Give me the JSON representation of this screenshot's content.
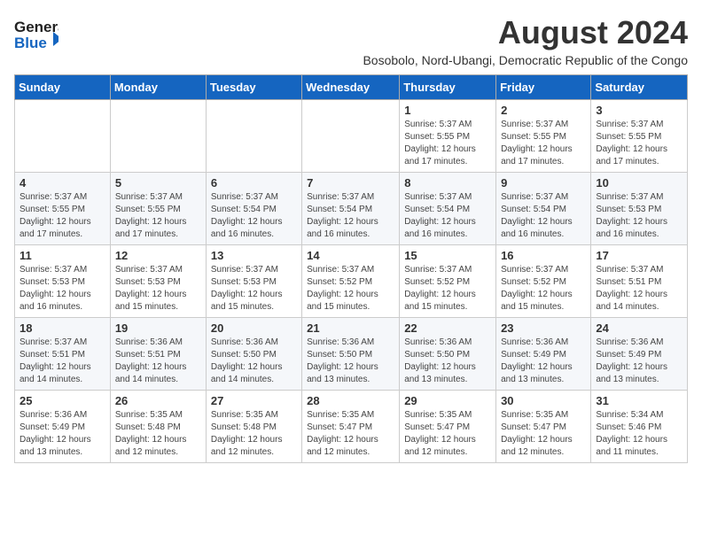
{
  "logo": {
    "general": "General",
    "blue": "Blue"
  },
  "title": "August 2024",
  "subtitle": "Bosobolo, Nord-Ubangi, Democratic Republic of the Congo",
  "days_of_week": [
    "Sunday",
    "Monday",
    "Tuesday",
    "Wednesday",
    "Thursday",
    "Friday",
    "Saturday"
  ],
  "weeks": [
    {
      "cells": [
        {
          "day": "",
          "info": ""
        },
        {
          "day": "",
          "info": ""
        },
        {
          "day": "",
          "info": ""
        },
        {
          "day": "",
          "info": ""
        },
        {
          "day": "1",
          "info": "Sunrise: 5:37 AM\nSunset: 5:55 PM\nDaylight: 12 hours\nand 17 minutes."
        },
        {
          "day": "2",
          "info": "Sunrise: 5:37 AM\nSunset: 5:55 PM\nDaylight: 12 hours\nand 17 minutes."
        },
        {
          "day": "3",
          "info": "Sunrise: 5:37 AM\nSunset: 5:55 PM\nDaylight: 12 hours\nand 17 minutes."
        }
      ]
    },
    {
      "cells": [
        {
          "day": "4",
          "info": "Sunrise: 5:37 AM\nSunset: 5:55 PM\nDaylight: 12 hours\nand 17 minutes."
        },
        {
          "day": "5",
          "info": "Sunrise: 5:37 AM\nSunset: 5:55 PM\nDaylight: 12 hours\nand 17 minutes."
        },
        {
          "day": "6",
          "info": "Sunrise: 5:37 AM\nSunset: 5:54 PM\nDaylight: 12 hours\nand 16 minutes."
        },
        {
          "day": "7",
          "info": "Sunrise: 5:37 AM\nSunset: 5:54 PM\nDaylight: 12 hours\nand 16 minutes."
        },
        {
          "day": "8",
          "info": "Sunrise: 5:37 AM\nSunset: 5:54 PM\nDaylight: 12 hours\nand 16 minutes."
        },
        {
          "day": "9",
          "info": "Sunrise: 5:37 AM\nSunset: 5:54 PM\nDaylight: 12 hours\nand 16 minutes."
        },
        {
          "day": "10",
          "info": "Sunrise: 5:37 AM\nSunset: 5:53 PM\nDaylight: 12 hours\nand 16 minutes."
        }
      ]
    },
    {
      "cells": [
        {
          "day": "11",
          "info": "Sunrise: 5:37 AM\nSunset: 5:53 PM\nDaylight: 12 hours\nand 16 minutes."
        },
        {
          "day": "12",
          "info": "Sunrise: 5:37 AM\nSunset: 5:53 PM\nDaylight: 12 hours\nand 15 minutes."
        },
        {
          "day": "13",
          "info": "Sunrise: 5:37 AM\nSunset: 5:53 PM\nDaylight: 12 hours\nand 15 minutes."
        },
        {
          "day": "14",
          "info": "Sunrise: 5:37 AM\nSunset: 5:52 PM\nDaylight: 12 hours\nand 15 minutes."
        },
        {
          "day": "15",
          "info": "Sunrise: 5:37 AM\nSunset: 5:52 PM\nDaylight: 12 hours\nand 15 minutes."
        },
        {
          "day": "16",
          "info": "Sunrise: 5:37 AM\nSunset: 5:52 PM\nDaylight: 12 hours\nand 15 minutes."
        },
        {
          "day": "17",
          "info": "Sunrise: 5:37 AM\nSunset: 5:51 PM\nDaylight: 12 hours\nand 14 minutes."
        }
      ]
    },
    {
      "cells": [
        {
          "day": "18",
          "info": "Sunrise: 5:37 AM\nSunset: 5:51 PM\nDaylight: 12 hours\nand 14 minutes."
        },
        {
          "day": "19",
          "info": "Sunrise: 5:36 AM\nSunset: 5:51 PM\nDaylight: 12 hours\nand 14 minutes."
        },
        {
          "day": "20",
          "info": "Sunrise: 5:36 AM\nSunset: 5:50 PM\nDaylight: 12 hours\nand 14 minutes."
        },
        {
          "day": "21",
          "info": "Sunrise: 5:36 AM\nSunset: 5:50 PM\nDaylight: 12 hours\nand 13 minutes."
        },
        {
          "day": "22",
          "info": "Sunrise: 5:36 AM\nSunset: 5:50 PM\nDaylight: 12 hours\nand 13 minutes."
        },
        {
          "day": "23",
          "info": "Sunrise: 5:36 AM\nSunset: 5:49 PM\nDaylight: 12 hours\nand 13 minutes."
        },
        {
          "day": "24",
          "info": "Sunrise: 5:36 AM\nSunset: 5:49 PM\nDaylight: 12 hours\nand 13 minutes."
        }
      ]
    },
    {
      "cells": [
        {
          "day": "25",
          "info": "Sunrise: 5:36 AM\nSunset: 5:49 PM\nDaylight: 12 hours\nand 13 minutes."
        },
        {
          "day": "26",
          "info": "Sunrise: 5:35 AM\nSunset: 5:48 PM\nDaylight: 12 hours\nand 12 minutes."
        },
        {
          "day": "27",
          "info": "Sunrise: 5:35 AM\nSunset: 5:48 PM\nDaylight: 12 hours\nand 12 minutes."
        },
        {
          "day": "28",
          "info": "Sunrise: 5:35 AM\nSunset: 5:47 PM\nDaylight: 12 hours\nand 12 minutes."
        },
        {
          "day": "29",
          "info": "Sunrise: 5:35 AM\nSunset: 5:47 PM\nDaylight: 12 hours\nand 12 minutes."
        },
        {
          "day": "30",
          "info": "Sunrise: 5:35 AM\nSunset: 5:47 PM\nDaylight: 12 hours\nand 12 minutes."
        },
        {
          "day": "31",
          "info": "Sunrise: 5:34 AM\nSunset: 5:46 PM\nDaylight: 12 hours\nand 11 minutes."
        }
      ]
    }
  ]
}
